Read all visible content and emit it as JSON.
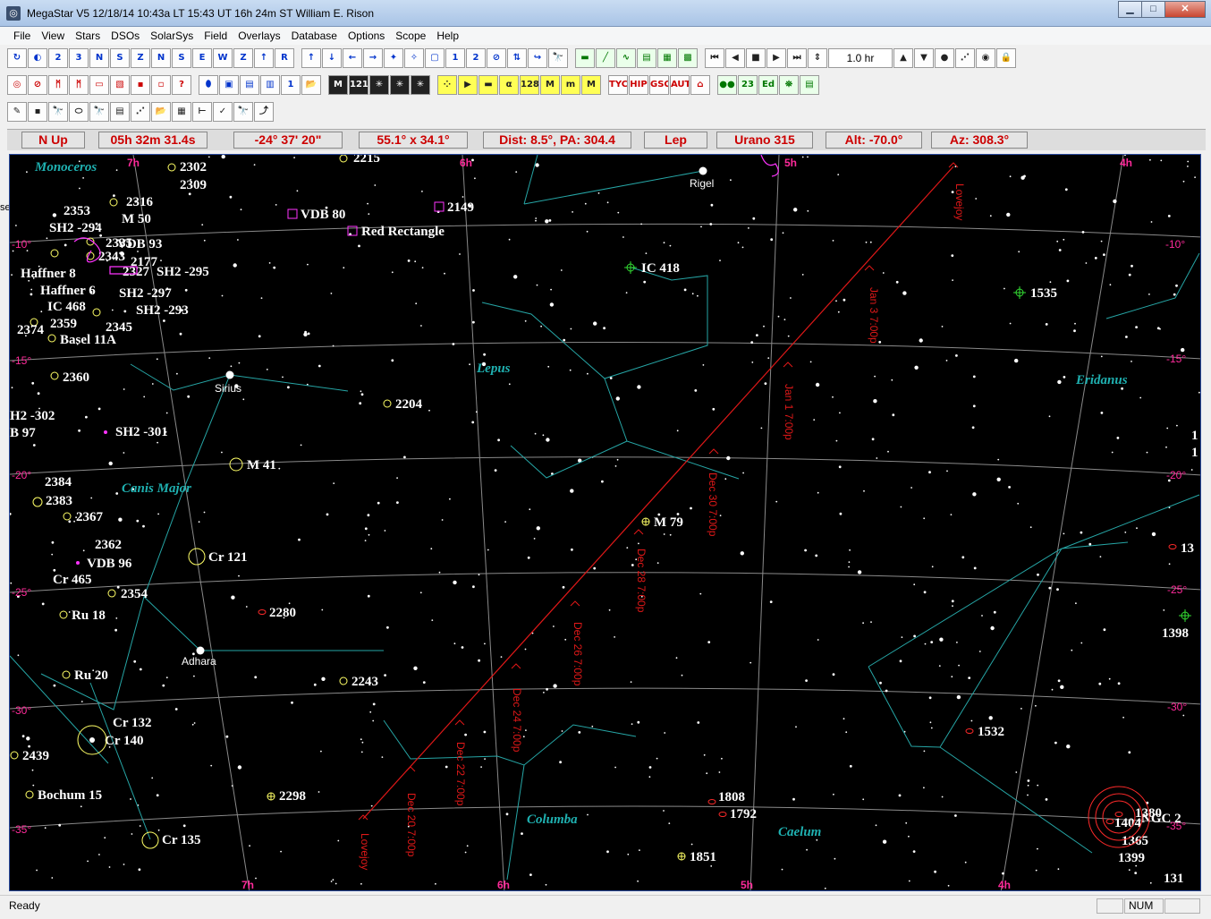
{
  "window": {
    "title": "MegaStar V5   12/18/14  10:43a LT    15:43 UT    16h 24m ST    William E. Rison",
    "btn_min": "▁",
    "btn_max": "□",
    "btn_close": "✕"
  },
  "menu": [
    "File",
    "View",
    "Stars",
    "DSOs",
    "SolarSys",
    "Field",
    "Overlays",
    "Database",
    "Options",
    "Scope",
    "Help"
  ],
  "toolbar": {
    "row1a": [
      "↻",
      "◐",
      "2",
      "3",
      "N",
      "S",
      "Z",
      "N",
      "S",
      "E",
      "W",
      "Z",
      "↑",
      "R"
    ],
    "row1b": [
      "↑",
      "↓",
      "←",
      "→",
      "✦",
      "✧",
      "▢",
      "1",
      "2",
      "⊘",
      "⇅",
      "↪",
      "🔭"
    ],
    "row1c": [
      "▬",
      "╱",
      "∿",
      "▤",
      "▦",
      "▩"
    ],
    "row1d": [
      "⏮",
      "◀",
      "■",
      "▶",
      "⏭",
      "⇕"
    ],
    "speed": "1.0 hr",
    "row1e": [
      "▲",
      "▼",
      "●",
      "⋰",
      "◉",
      "🔒"
    ],
    "row2a": [
      "◎",
      "⊘",
      "ᛗ",
      "ᛗ",
      "▭",
      "▧",
      "▪",
      "▫",
      "?"
    ],
    "row2b": [
      "⬮",
      "▣",
      "▤",
      "▥",
      "1",
      "📂"
    ],
    "row2c": [
      "M",
      "121",
      "✳",
      "✳",
      "✳"
    ],
    "row2d": [
      "⁘",
      "▶",
      "▬",
      "α",
      "128",
      "M",
      "m",
      "M"
    ],
    "row2e": [
      "TYC",
      "HIP",
      "GSC",
      "AUT",
      "⌂"
    ],
    "row2f": [
      "●●",
      "23",
      "Ed",
      "⛯",
      "▤"
    ],
    "row3": [
      "✎",
      "▪",
      "🔭",
      "⬭",
      "🔭",
      "▤",
      "⋰",
      "📂",
      "▦",
      "⊢",
      "✓",
      "🔭",
      "⤴"
    ]
  },
  "status": {
    "orientation": "N Up",
    "ra": "05h 32m 31.4s",
    "dec": "-24° 37' 20\"",
    "fov": "55.1° x 34.1°",
    "dist": "Dist: 8.5°, PA: 304.4",
    "constellation": "Lep",
    "urano": "Urano 315",
    "alt": "Alt: -70.0°",
    "az": "Az: 308.3°"
  },
  "chart": {
    "ra_labels": [
      {
        "text": "7h",
        "pos": "top"
      },
      {
        "text": "6h",
        "pos": "top"
      },
      {
        "text": "5h",
        "pos": "top"
      },
      {
        "text": "4h",
        "pos": "top"
      },
      {
        "text": "7h",
        "pos": "bottom"
      },
      {
        "text": "6h",
        "pos": "bottom"
      },
      {
        "text": "5h",
        "pos": "bottom"
      },
      {
        "text": "4h",
        "pos": "bottom"
      }
    ],
    "dec_labels": [
      "-10°",
      "-15°",
      "-20°",
      "-25°",
      "-30°",
      "-35°"
    ],
    "constellations": [
      "Monoceros",
      "Lepus",
      "Eridanus",
      "Canis Major",
      "Columba",
      "Caelum"
    ],
    "named_stars": [
      "Rigel",
      "Sirius",
      "Adhara"
    ],
    "objects": [
      "2215",
      "2302",
      "2309",
      "2316",
      "2353",
      "M 50",
      "SH2 -294",
      "2335",
      "VDB 93",
      "2343",
      "2177",
      "Haffner 8",
      "2327",
      "SH2 -295",
      "Haffner 6",
      "SH2 -297",
      "SH2 -293",
      "IC 468",
      "2359",
      "2374",
      "2345",
      "Basel 11A",
      "2360",
      "2204",
      "H2 -302",
      "B 97",
      "SH2 -301",
      "M 41",
      "2384",
      "2383",
      "2367",
      "2362",
      "VDB 96",
      "Cr 140",
      "Cr 465",
      "Cr 121",
      "2354",
      "2280",
      "Ru 18",
      "Ru 20",
      "2243",
      "Cr 132",
      "Cr 140",
      "2439",
      "Bochum 15",
      "2298",
      "Cr 135",
      "VDB 80",
      "2149",
      "Red Rectangle",
      "IC 418",
      "1535",
      "M 79",
      "1532",
      "1808",
      "1792",
      "1851",
      "1380",
      "1404",
      "1365",
      "1399",
      "NGC 2",
      "1",
      "1",
      "13",
      "1398",
      "131"
    ],
    "comet_dates": [
      "Lovejoy",
      "Jan 3 7:00p",
      "Jan 1 7:00p",
      "Dec 30 7:00p",
      "Dec 28 7:00p",
      "Dec 26 7:00p",
      "Dec 24 7:00p",
      "Dec 22 7:00p",
      "Dec 20 7:00p",
      "Lovejoy"
    ],
    "colors": {
      "grid": "#8a8a8a",
      "constellation_lines": "#26a6a6",
      "comet": "#e01818",
      "ra_dec_labels": "#ff2a9a",
      "dso": "#ffff66",
      "nebula": "#ff33ff",
      "cluster_text": "#ffffff",
      "const_name": "#1fb1b1"
    }
  },
  "statusbar": {
    "ready": "Ready",
    "num": "NUM"
  },
  "leftedge": "se"
}
